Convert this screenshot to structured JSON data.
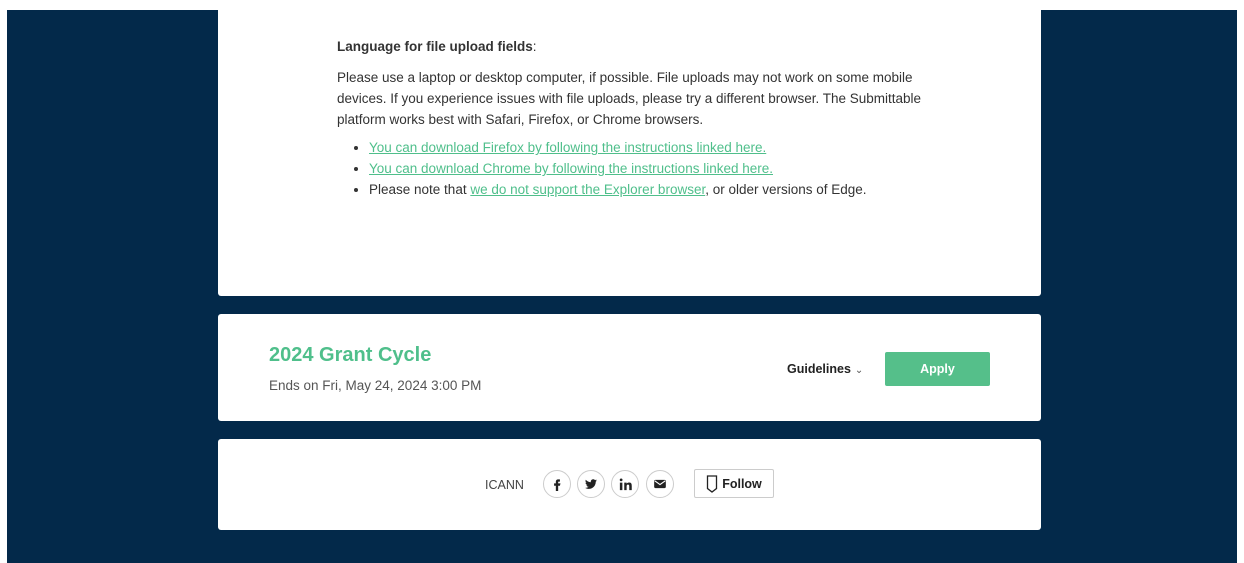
{
  "upload_info": {
    "heading": "Language for file upload fields",
    "heading_suffix": ":",
    "paragraph": "Please use a laptop or desktop computer, if possible. File uploads may not work on some mobile devices. If you experience issues with file uploads, please try a different browser. The Submittable platform works best with Safari, Firefox, or Chrome browsers.",
    "firefox_link": "You can download Firefox by following the instructions linked here.",
    "chrome_link": "You can download Chrome by following the instructions linked here.",
    "explorer_prefix": "Please note that ",
    "explorer_link": "we do not support the Explorer browser",
    "explorer_suffix": ", or older versions of Edge."
  },
  "grant": {
    "title": "2024 Grant Cycle",
    "ends": "Ends on Fri, May 24, 2024 3:00 PM",
    "guidelines_label": "Guidelines",
    "apply_label": "Apply"
  },
  "footer": {
    "org_name": "ICANN",
    "social_icons": [
      "facebook-icon",
      "twitter-icon",
      "linkedin-icon",
      "mail-icon"
    ],
    "follow_label": "Follow"
  },
  "colors": {
    "background": "#03294a",
    "accent": "#4fbf8b",
    "apply_button": "#55bf8a"
  }
}
